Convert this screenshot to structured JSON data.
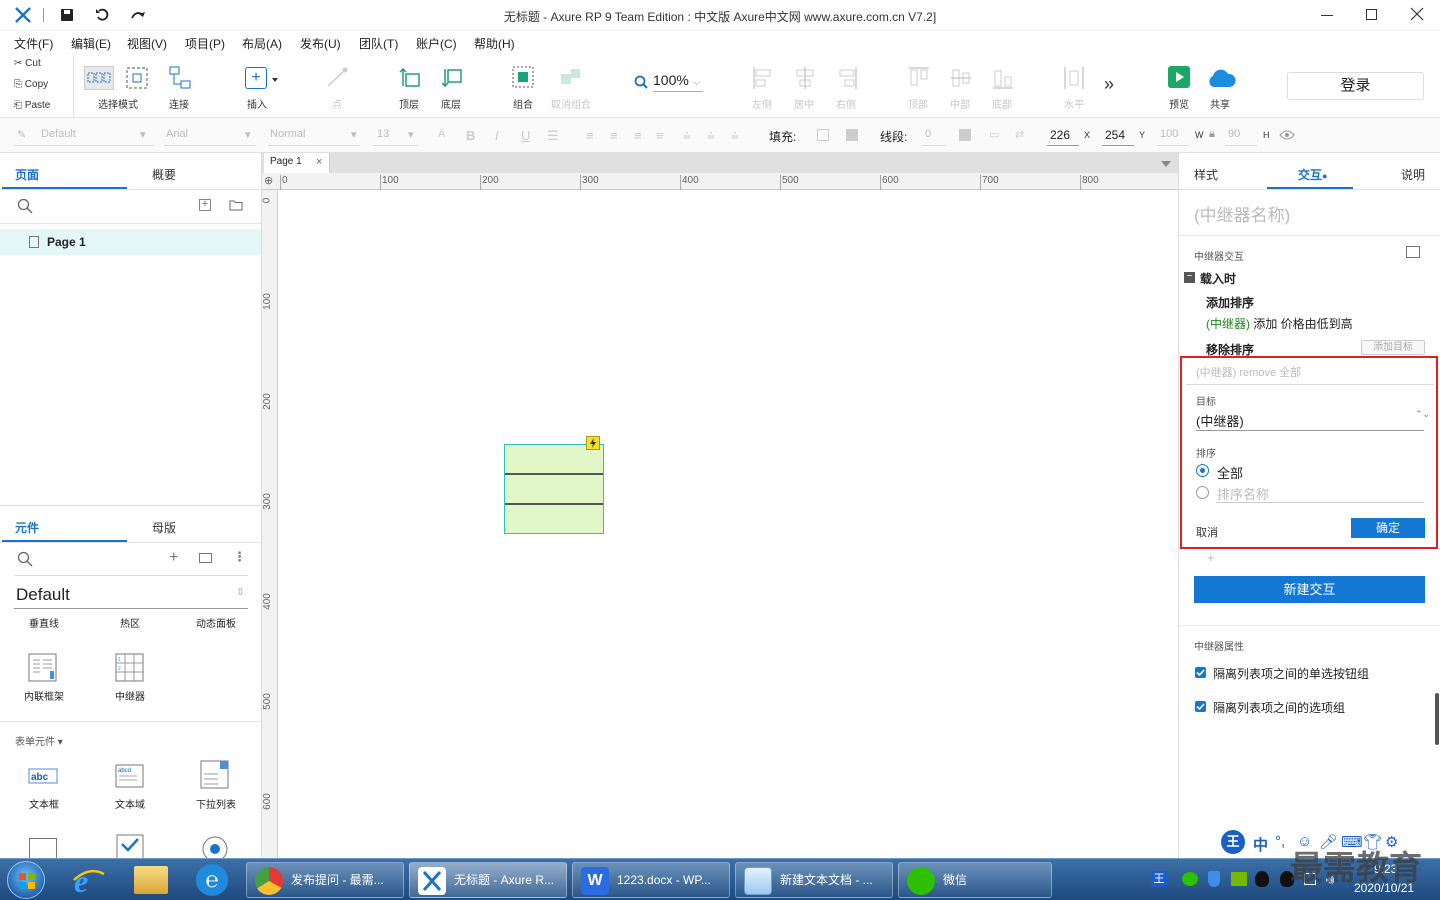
{
  "window": {
    "title": "无标题 - Axure RP 9 Team Edition : 中文版   Axure中文网 www.axure.com.cn V7.2]"
  },
  "menu": [
    "文件(F)",
    "编辑(E)",
    "视图(V)",
    "项目(P)",
    "布局(A)",
    "发布(U)",
    "团队(T)",
    "账户(C)",
    "帮助(H)"
  ],
  "clipboard": {
    "cut": "Cut",
    "copy": "Copy",
    "paste": "Paste"
  },
  "toolbar": {
    "select_mode": "选择模式",
    "connect": "连接",
    "insert": "插入",
    "point": "点",
    "top": "顶层",
    "bottom": "底层",
    "group": "组合",
    "ungroup": "取消组合",
    "zoom": "100%",
    "align_left": "左侧",
    "align_center": "居中",
    "align_right": "右侧",
    "align_top": "顶部",
    "align_middle": "中部",
    "align_bottom": "底部",
    "distribute_h": "水平",
    "more": "»",
    "preview": "预览",
    "share": "共享",
    "login": "登录"
  },
  "format": {
    "style": "Default",
    "font": "Arial",
    "weight": "Normal",
    "size": "13",
    "fill_label": "填充:",
    "stroke_label": "线段:",
    "stroke_value": "0",
    "x": "226",
    "x_label": "X",
    "y": "254",
    "y_label": "Y",
    "w": "100",
    "w_label": "W",
    "h": "90",
    "h_label": "H"
  },
  "left": {
    "tabs": [
      "页面",
      "概要"
    ],
    "pages": [
      "Page 1"
    ],
    "lib_tabs": [
      "元件",
      "母版"
    ],
    "library": "Default",
    "widgets_row1": [
      "垂直线",
      "热区",
      "动态面板"
    ],
    "widgets_row2": [
      "内联框架",
      "中继器"
    ],
    "form_section": "表单元件",
    "widgets_row3": [
      "文本框",
      "文本域",
      "下拉列表"
    ]
  },
  "canvas": {
    "tab": "Page 1",
    "hruler": [
      "0",
      "100",
      "200",
      "300",
      "400",
      "500",
      "600",
      "700",
      "800"
    ],
    "vruler": [
      "0",
      "100",
      "200",
      "300",
      "400",
      "500",
      "600"
    ]
  },
  "right": {
    "tabs": [
      "样式",
      "交互",
      "说明"
    ],
    "name_placeholder": "(中继器名称)",
    "section_title": "中继器交互",
    "event": "载入时",
    "action1": "添加排序",
    "action1_target": "(中继器)",
    "action1_desc": "添加 价格由低到高",
    "action2": "移除排序",
    "add_target": "添加目标",
    "edit_summary": "(中继器) remove 全部",
    "target_label": "目标",
    "target_value": "(中继器)",
    "sort_label": "排序",
    "opt_all": "全部",
    "opt_name_placeholder": "排序名称",
    "cancel": "取消",
    "ok": "确定",
    "plus": "+",
    "new_interaction": "新建交互",
    "props_title": "中继器属性",
    "check1": "隔离列表项之间的单选按钮组",
    "check2": "隔离列表项之间的选项组"
  },
  "taskbar": {
    "apps": [
      "发布提问 - 最需...",
      "无标题 - Axure R...",
      "1223.docx - WP...",
      "新建文本文档 - ...",
      "微信"
    ],
    "time": "9:23",
    "date": "2020/10/21",
    "ime": "中",
    "watermark": "最需教育"
  },
  "colors": {
    "accent": "#1a73c8",
    "button_blue": "#1278d4",
    "highlight_red": "#e02020",
    "widget_fill": "#e2f7c8",
    "widget_border": "#2cc2c2",
    "page_selected": "#e3f7f7"
  }
}
